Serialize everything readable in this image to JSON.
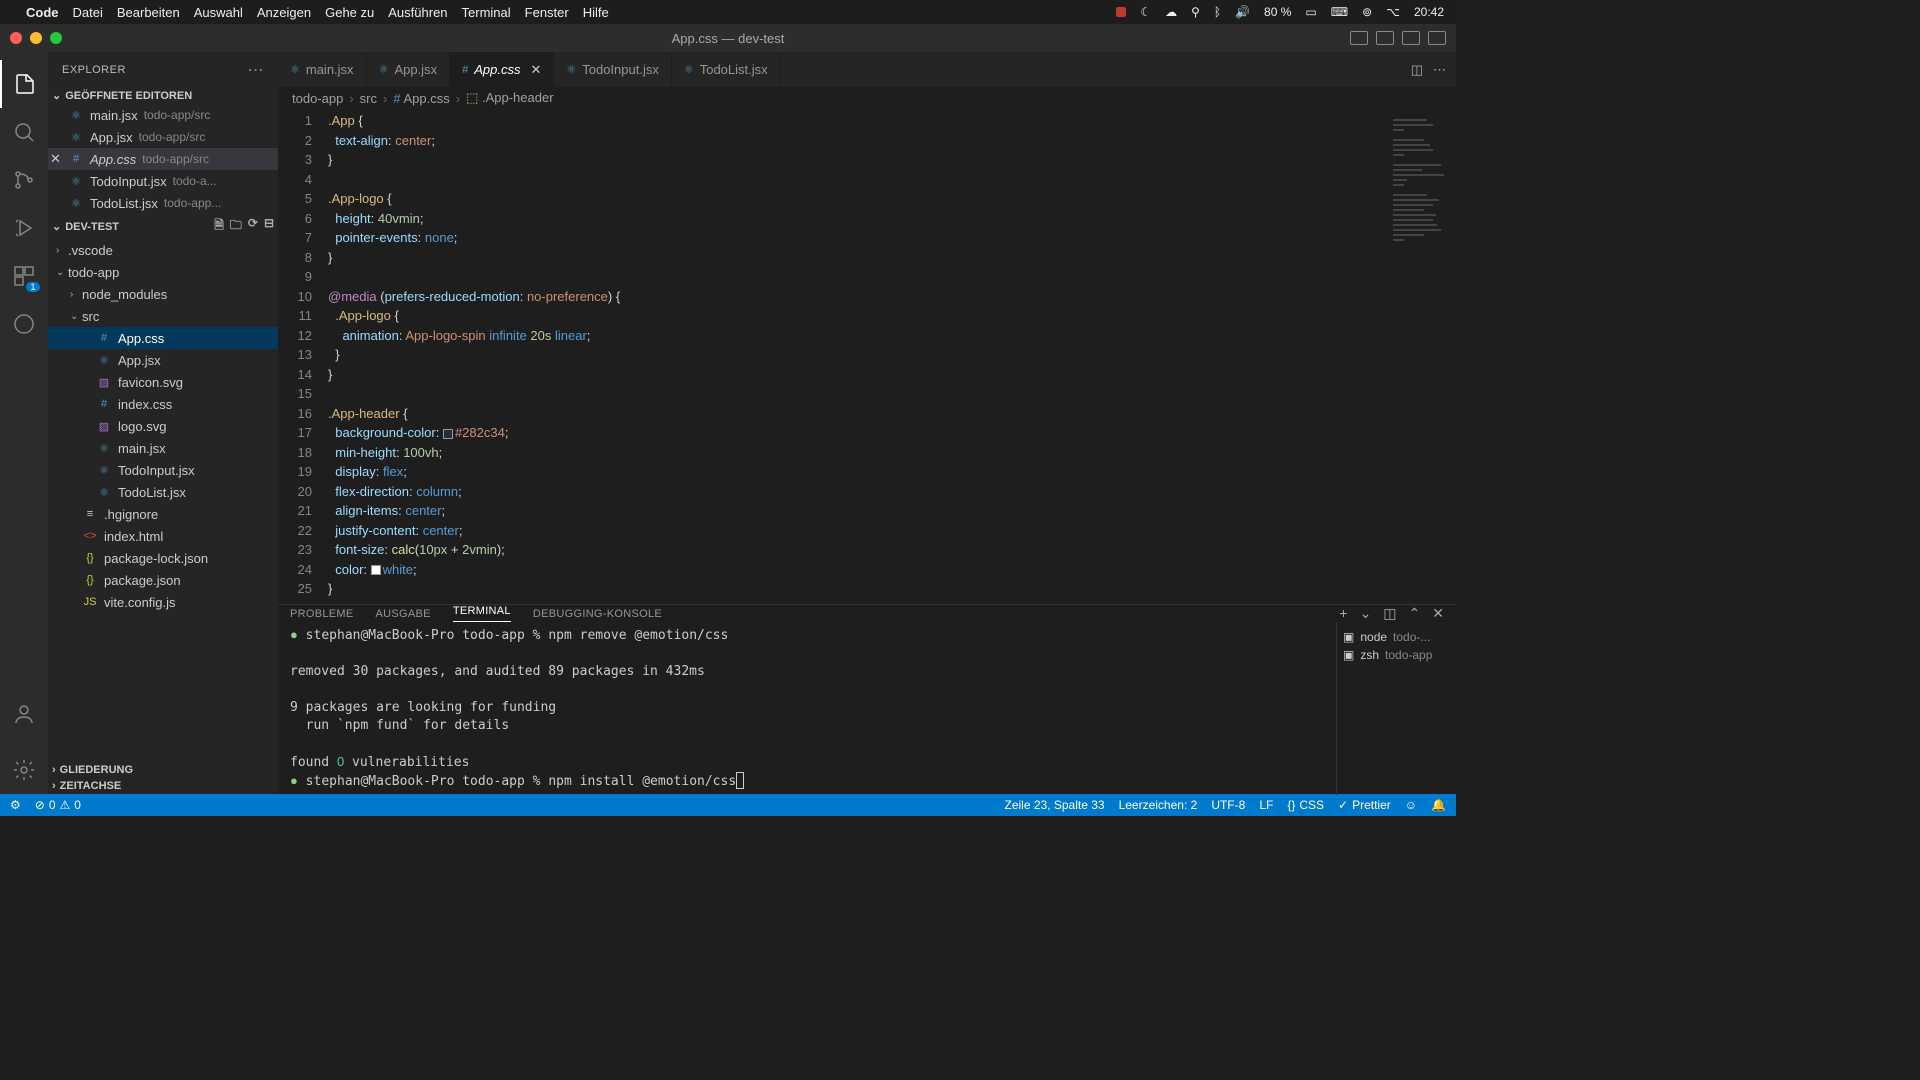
{
  "menubar": {
    "app": "Code",
    "items": [
      "Datei",
      "Bearbeiten",
      "Auswahl",
      "Anzeigen",
      "Gehe zu",
      "Ausführen",
      "Terminal",
      "Fenster",
      "Hilfe"
    ],
    "battery": "80 %",
    "time": "20:42"
  },
  "titlebar": {
    "title": "App.css — dev-test"
  },
  "sidebar": {
    "title": "EXPLORER",
    "open_editors_label": "GEÖFFNETE EDITOREN",
    "open_editors": [
      {
        "name": "main.jsx",
        "path": "todo-app/src",
        "icon": "react"
      },
      {
        "name": "App.jsx",
        "path": "todo-app/src",
        "icon": "react"
      },
      {
        "name": "App.css",
        "path": "todo-app/src",
        "icon": "css",
        "active": true
      },
      {
        "name": "TodoInput.jsx",
        "path": "todo-a...",
        "icon": "react"
      },
      {
        "name": "TodoList.jsx",
        "path": "todo-app...",
        "icon": "react"
      }
    ],
    "workspace": "DEV-TEST",
    "tree": [
      {
        "name": ".vscode",
        "type": "folder",
        "depth": 0,
        "expanded": false
      },
      {
        "name": "todo-app",
        "type": "folder",
        "depth": 0,
        "expanded": true
      },
      {
        "name": "node_modules",
        "type": "folder",
        "depth": 1,
        "expanded": false
      },
      {
        "name": "src",
        "type": "folder",
        "depth": 1,
        "expanded": true
      },
      {
        "name": "App.css",
        "type": "file",
        "depth": 2,
        "icon": "css",
        "selected": true
      },
      {
        "name": "App.jsx",
        "type": "file",
        "depth": 2,
        "icon": "react"
      },
      {
        "name": "favicon.svg",
        "type": "file",
        "depth": 2,
        "icon": "svg"
      },
      {
        "name": "index.css",
        "type": "file",
        "depth": 2,
        "icon": "css"
      },
      {
        "name": "logo.svg",
        "type": "file",
        "depth": 2,
        "icon": "svg"
      },
      {
        "name": "main.jsx",
        "type": "file",
        "depth": 2,
        "icon": "react"
      },
      {
        "name": "TodoInput.jsx",
        "type": "file",
        "depth": 2,
        "icon": "react"
      },
      {
        "name": "TodoList.jsx",
        "type": "file",
        "depth": 2,
        "icon": "react"
      },
      {
        "name": ".hgignore",
        "type": "file",
        "depth": 1,
        "icon": "conf"
      },
      {
        "name": "index.html",
        "type": "file",
        "depth": 1,
        "icon": "html"
      },
      {
        "name": "package-lock.json",
        "type": "file",
        "depth": 1,
        "icon": "json"
      },
      {
        "name": "package.json",
        "type": "file",
        "depth": 1,
        "icon": "json"
      },
      {
        "name": "vite.config.js",
        "type": "file",
        "depth": 1,
        "icon": "js"
      }
    ],
    "outline": "GLIEDERUNG",
    "timeline": "ZEITACHSE"
  },
  "tabs": [
    {
      "name": "main.jsx",
      "icon": "react"
    },
    {
      "name": "App.jsx",
      "icon": "react"
    },
    {
      "name": "App.css",
      "icon": "css",
      "active": true
    },
    {
      "name": "TodoInput.jsx",
      "icon": "react"
    },
    {
      "name": "TodoList.jsx",
      "icon": "react"
    }
  ],
  "breadcrumb": [
    "todo-app",
    "src",
    "App.css",
    ".App-header"
  ],
  "code_lines": [
    {
      "n": 1,
      "html": "<span class='c-sel'>.App</span> <span class='c-punc'>{</span>"
    },
    {
      "n": 2,
      "html": "  <span class='c-prop'>text-align</span><span class='c-punc'>:</span> <span class='c-val'>center</span><span class='c-punc'>;</span>"
    },
    {
      "n": 3,
      "html": "<span class='c-punc'>}</span>"
    },
    {
      "n": 4,
      "html": ""
    },
    {
      "n": 5,
      "html": "<span class='c-sel'>.App-logo</span> <span class='c-punc'>{</span>"
    },
    {
      "n": 6,
      "html": "  <span class='c-prop'>height</span><span class='c-punc'>:</span> <span class='c-num'>40vmin</span><span class='c-punc'>;</span>"
    },
    {
      "n": 7,
      "html": "  <span class='c-prop'>pointer-events</span><span class='c-punc'>:</span> <span class='c-const'>none</span><span class='c-punc'>;</span>"
    },
    {
      "n": 8,
      "html": "<span class='c-punc'>}</span>"
    },
    {
      "n": 9,
      "html": ""
    },
    {
      "n": 10,
      "html": "<span class='c-kw'>@media</span> <span class='c-punc'>(</span><span class='c-prop'>prefers-reduced-motion</span><span class='c-punc'>:</span> <span class='c-val'>no-preference</span><span class='c-punc'>) {</span>"
    },
    {
      "n": 11,
      "html": "  <span class='c-sel'>.App-logo</span> <span class='c-punc'>{</span>"
    },
    {
      "n": 12,
      "html": "    <span class='c-prop'>animation</span><span class='c-punc'>:</span> <span class='c-val'>App-logo-spin</span> <span class='c-const'>infinite</span> <span class='c-num'>20s</span> <span class='c-const'>linear</span><span class='c-punc'>;</span>"
    },
    {
      "n": 13,
      "html": "  <span class='c-punc'>}</span>"
    },
    {
      "n": 14,
      "html": "<span class='c-punc'>}</span>"
    },
    {
      "n": 15,
      "html": ""
    },
    {
      "n": 16,
      "html": "<span class='c-sel'>.App-header</span> <span class='c-punc'>{</span>"
    },
    {
      "n": 17,
      "html": "  <span class='c-prop'>background-color</span><span class='c-punc'>:</span> <span class='swatch' style='background:#282c34'></span><span class='c-val'>#282c34</span><span class='c-punc'>;</span>"
    },
    {
      "n": 18,
      "html": "  <span class='c-prop'>min-height</span><span class='c-punc'>:</span> <span class='c-num'>100vh</span><span class='c-punc'>;</span>"
    },
    {
      "n": 19,
      "html": "  <span class='c-prop'>display</span><span class='c-punc'>:</span> <span class='c-const'>flex</span><span class='c-punc'>;</span>"
    },
    {
      "n": 20,
      "html": "  <span class='c-prop'>flex-direction</span><span class='c-punc'>:</span> <span class='c-const'>column</span><span class='c-punc'>;</span>"
    },
    {
      "n": 21,
      "html": "  <span class='c-prop'>align-items</span><span class='c-punc'>:</span> <span class='c-const'>center</span><span class='c-punc'>;</span>"
    },
    {
      "n": 22,
      "html": "  <span class='c-prop'>justify-content</span><span class='c-punc'>:</span> <span class='c-const'>center</span><span class='c-punc'>;</span>"
    },
    {
      "n": 23,
      "html": "  <span class='c-prop'>font-size</span><span class='c-punc'>:</span> <span class='c-func'>calc</span><span class='c-punc'>(</span><span class='c-num'>10px</span> <span class='c-punc'>+</span> <span class='c-num'>2vmin</span><span class='c-punc'>);</span>"
    },
    {
      "n": 24,
      "html": "  <span class='c-prop'>color</span><span class='c-punc'>:</span> <span class='swatch' style='background:#fff'></span><span class='c-const'>white</span><span class='c-punc'>;</span>"
    },
    {
      "n": 25,
      "html": "<span class='c-punc'>}</span>"
    }
  ],
  "panel": {
    "tabs": [
      "PROBLEME",
      "AUSGABE",
      "TERMINAL",
      "DEBUGGING-KONSOLE"
    ],
    "active_tab": 2,
    "terminal_lines": [
      "<span class='dot'>●</span> stephan@MacBook-Pro todo-app % npm remove @emotion/css",
      "",
      "removed 30 packages, and audited 89 packages in 432ms",
      "",
      "9 packages are looking for funding",
      "  run `npm fund` for details",
      "",
      "found <span class='green'>0</span> vulnerabilities",
      "<span class='dot'>●</span> stephan@MacBook-Pro todo-app % npm install @emotion/css<span style='border:1px solid #ccc;padding:0 1px;'>&nbsp;</span>"
    ],
    "term_sessions": [
      {
        "icon": "▣",
        "name": "node",
        "dim": "todo-..."
      },
      {
        "icon": "▣",
        "name": "zsh",
        "dim": "todo-app"
      }
    ]
  },
  "statusbar": {
    "errors": "0",
    "warnings": "0",
    "position": "Zeile 23, Spalte 33",
    "spaces": "Leerzeichen: 2",
    "encoding": "UTF-8",
    "eol": "LF",
    "lang": "CSS",
    "prettier": "Prettier"
  },
  "activity_badge": "1"
}
